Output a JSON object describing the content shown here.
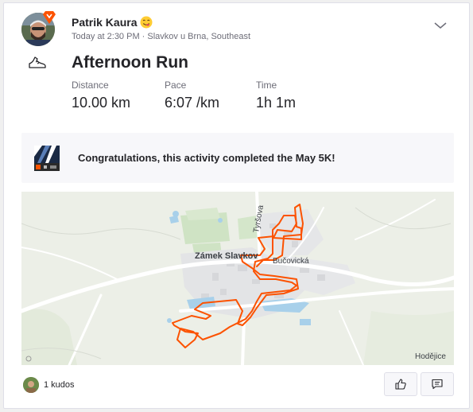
{
  "athlete": {
    "name": "Patrik Kaura",
    "emoji_icon": "face-savoring-food-emoji",
    "meta": "Today at 2:30 PM · Slavkov u Brna, Southeast"
  },
  "activity": {
    "type_icon": "running-shoe-icon",
    "title": "Afternoon Run",
    "stats": [
      {
        "label": "Distance",
        "value": "10.00 km"
      },
      {
        "label": "Pace",
        "value": "6:07 /km"
      },
      {
        "label": "Time",
        "value": "1h 1m"
      }
    ]
  },
  "challenge": {
    "text": "Congratulations, this activity completed the May 5K!"
  },
  "map": {
    "labels": {
      "town": "Zámek Slavkov",
      "street1": "Tyršova",
      "street2": "Bučovická",
      "village": "Hodějice"
    },
    "route_color": "#fc5200"
  },
  "social": {
    "kudos_text": "1 kudos"
  },
  "colors": {
    "brand": "#fc5200",
    "text": "#242428",
    "muted": "#6d6d78"
  }
}
